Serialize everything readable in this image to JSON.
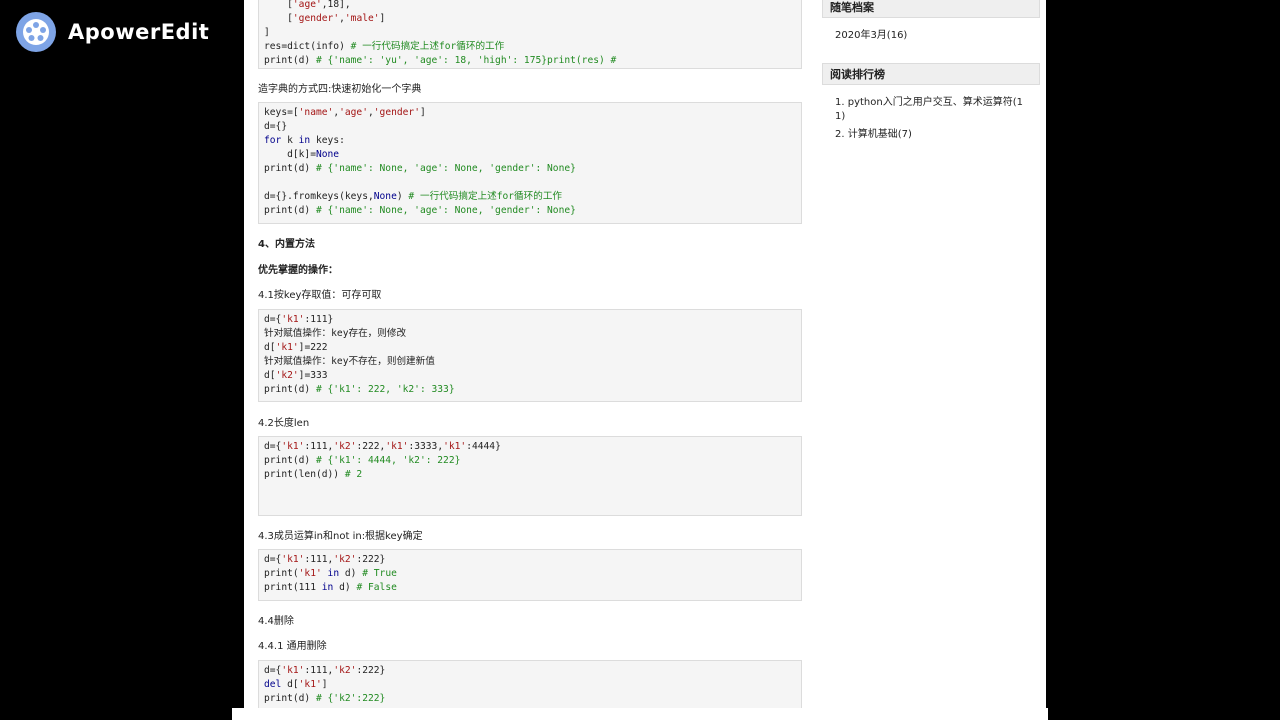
{
  "watermark": {
    "text": "ApowerEdit"
  },
  "article": {
    "block1": [
      [
        {
          "t": "    [",
          "c": ""
        },
        {
          "t": "'age'",
          "c": "s"
        },
        {
          "t": ",18],",
          "c": ""
        }
      ],
      [
        {
          "t": "    [",
          "c": ""
        },
        {
          "t": "'gender'",
          "c": "s"
        },
        {
          "t": ",",
          "c": ""
        },
        {
          "t": "'male'",
          "c": "s"
        },
        {
          "t": "]",
          "c": ""
        }
      ],
      [
        {
          "t": "]",
          "c": ""
        }
      ],
      [
        {
          "t": "res=dict(info) ",
          "c": ""
        },
        {
          "t": "# 一行代码搞定上述for循环的工作",
          "c": "c"
        }
      ],
      [
        {
          "t": "print(d) ",
          "c": ""
        },
        {
          "t": "# {'name': 'yu', 'age': 18, 'high': 175}print(res) #",
          "c": "c"
        }
      ]
    ],
    "p_method4": "造字典的方式四:快速初始化一个字典",
    "block2": [
      [
        {
          "t": "keys=[",
          "c": ""
        },
        {
          "t": "'name'",
          "c": "s"
        },
        {
          "t": ",",
          "c": ""
        },
        {
          "t": "'age'",
          "c": "s"
        },
        {
          "t": ",",
          "c": ""
        },
        {
          "t": "'gender'",
          "c": "s"
        },
        {
          "t": "]",
          "c": ""
        }
      ],
      [
        {
          "t": "d={}",
          "c": ""
        }
      ],
      [
        {
          "t": "for",
          "c": "k"
        },
        {
          "t": " k ",
          "c": ""
        },
        {
          "t": "in",
          "c": "k"
        },
        {
          "t": " keys:",
          "c": ""
        }
      ],
      [
        {
          "t": "    d[k]=",
          "c": ""
        },
        {
          "t": "None",
          "c": "k"
        }
      ],
      [
        {
          "t": "print(d) ",
          "c": ""
        },
        {
          "t": "# {'name': None, 'age': None, 'gender': None}",
          "c": "c"
        }
      ],
      [
        {
          "t": "",
          "c": ""
        }
      ],
      [
        {
          "t": "d={}.fromkeys(keys,",
          "c": ""
        },
        {
          "t": "None",
          "c": "k"
        },
        {
          "t": ") ",
          "c": ""
        },
        {
          "t": "# 一行代码搞定上述for循环的工作",
          "c": "c"
        }
      ],
      [
        {
          "t": "print(d) ",
          "c": ""
        },
        {
          "t": "# {'name': None, 'age': None, 'gender': None}",
          "c": "c"
        }
      ]
    ],
    "h_builtin": "4、内置方法",
    "h_priority": "优先掌握的操作：",
    "p_41": "4.1按key存取值：可存可取",
    "block3": [
      [
        {
          "t": "d={",
          "c": ""
        },
        {
          "t": "'k1'",
          "c": "s"
        },
        {
          "t": ":111}",
          "c": ""
        }
      ],
      [
        {
          "t": "针对赋值操作：key存在，则修改",
          "c": ""
        }
      ],
      [
        {
          "t": "d[",
          "c": ""
        },
        {
          "t": "'k1'",
          "c": "s"
        },
        {
          "t": "]=222",
          "c": ""
        }
      ],
      [
        {
          "t": "针对赋值操作：key不存在，则创建新值",
          "c": ""
        }
      ],
      [
        {
          "t": "d[",
          "c": ""
        },
        {
          "t": "'k2'",
          "c": "s"
        },
        {
          "t": "]=333",
          "c": ""
        }
      ],
      [
        {
          "t": "print(d) ",
          "c": ""
        },
        {
          "t": "# {'k1': 222, 'k2': 333}",
          "c": "c"
        }
      ]
    ],
    "p_42": "4.2长度len",
    "block4": [
      [
        {
          "t": "d={",
          "c": ""
        },
        {
          "t": "'k1'",
          "c": "s"
        },
        {
          "t": ":111,",
          "c": ""
        },
        {
          "t": "'k2'",
          "c": "s"
        },
        {
          "t": ":222,",
          "c": ""
        },
        {
          "t": "'k1'",
          "c": "s"
        },
        {
          "t": ":3333,",
          "c": ""
        },
        {
          "t": "'k1'",
          "c": "s"
        },
        {
          "t": ":4444}",
          "c": ""
        }
      ],
      [
        {
          "t": "print(d) ",
          "c": ""
        },
        {
          "t": "# {'k1': 4444, 'k2': 222}",
          "c": "c"
        }
      ],
      [
        {
          "t": "print(len(d)) ",
          "c": ""
        },
        {
          "t": "# 2",
          "c": "c"
        }
      ]
    ],
    "p_43": "4.3成员运算in和not in:根据key确定",
    "block5": [
      [
        {
          "t": "d={",
          "c": ""
        },
        {
          "t": "'k1'",
          "c": "s"
        },
        {
          "t": ":111,",
          "c": ""
        },
        {
          "t": "'k2'",
          "c": "s"
        },
        {
          "t": ":222}",
          "c": ""
        }
      ],
      [
        {
          "t": "print(",
          "c": ""
        },
        {
          "t": "'k1'",
          "c": "s"
        },
        {
          "t": " ",
          "c": ""
        },
        {
          "t": "in",
          "c": "k"
        },
        {
          "t": " d) ",
          "c": ""
        },
        {
          "t": "# True",
          "c": "c"
        }
      ],
      [
        {
          "t": "print(111 ",
          "c": ""
        },
        {
          "t": "in",
          "c": "k"
        },
        {
          "t": " d) ",
          "c": ""
        },
        {
          "t": "# False",
          "c": "c"
        }
      ]
    ],
    "p_44": "4.4删除",
    "p_441": "4.4.1 通用删除",
    "block6": [
      [
        {
          "t": "d={",
          "c": ""
        },
        {
          "t": "'k1'",
          "c": "s"
        },
        {
          "t": ":111,",
          "c": ""
        },
        {
          "t": "'k2'",
          "c": "s"
        },
        {
          "t": ":222}",
          "c": ""
        }
      ],
      [
        {
          "t": "del",
          "c": "k"
        },
        {
          "t": " d[",
          "c": ""
        },
        {
          "t": "'k1'",
          "c": "s"
        },
        {
          "t": "]",
          "c": ""
        }
      ],
      [
        {
          "t": "print(d) ",
          "c": ""
        },
        {
          "t": "# {'k2':222}",
          "c": "c"
        }
      ]
    ]
  },
  "sidebar": {
    "archive_title": "随笔档案",
    "archive_item": "2020年3月(16)",
    "ranking_title": "阅读排行榜",
    "rank_item_1_line1": "1. python入门之用户交互、算术运算符(1",
    "rank_item_1_line2": "1)",
    "rank_item_2": "2. 计算机基础(7)"
  }
}
